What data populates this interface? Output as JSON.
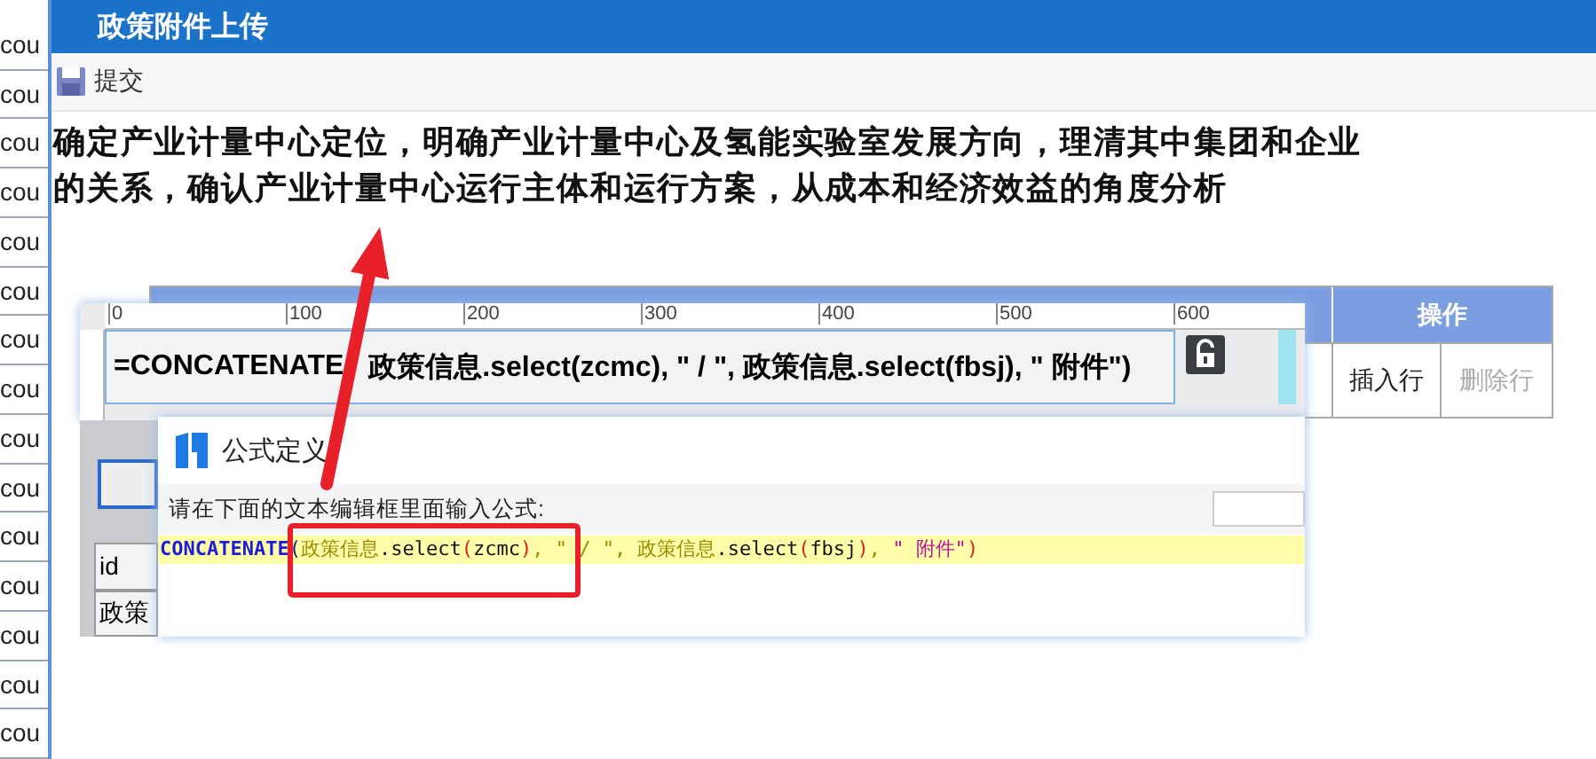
{
  "sidebar": {
    "items": [
      {
        "label": "cou"
      },
      {
        "label": "cou"
      },
      {
        "label": "cou"
      },
      {
        "label": "cou"
      },
      {
        "label": "cou"
      },
      {
        "label": "cou"
      },
      {
        "label": "cou"
      },
      {
        "label": "cou"
      },
      {
        "label": "cou"
      },
      {
        "label": "cou"
      },
      {
        "label": "cou"
      },
      {
        "label": "cou"
      },
      {
        "label": "cou"
      },
      {
        "label": "cou"
      },
      {
        "label": "cou"
      }
    ]
  },
  "window": {
    "title": "政策附件上传"
  },
  "toolbar": {
    "buttons": [
      {
        "label": "提交"
      }
    ]
  },
  "description": "确定产业计量中心定位，明确产业计量中心及氢能实验室发展方向，理清其中集团和企业的关系，确认产业计量中心运行主体和运行方案，从成本和经济效益的角度分析",
  "table": {
    "columns": [
      {
        "label": "操作"
      }
    ],
    "rows": [
      {
        "actions": [
          {
            "label": "插入行",
            "disabled": false
          },
          {
            "label": "删除行",
            "disabled": true
          }
        ]
      }
    ]
  },
  "formula_bar": {
    "ruler_marks": [
      "0",
      "100",
      "200",
      "300",
      "400",
      "500",
      "600"
    ],
    "segments": [
      "=CONCATENATE",
      "政策信息.select(zcmc), \" / \", 政策信息.select(fbsj), \" 附件\")"
    ]
  },
  "sheet": {
    "cells": [
      "id",
      "政策"
    ]
  },
  "dialog": {
    "title": "公式定义",
    "prompt": "请在下面的文本编辑框里面输入公式:",
    "formula_tokens": [
      {
        "text": "CONCATENATE",
        "kind": "function"
      },
      {
        "text": "(",
        "kind": "bracket"
      },
      {
        "text": "政策信息",
        "kind": "name"
      },
      {
        "text": ".select",
        "kind": "plain"
      },
      {
        "text": "(",
        "kind": "paren"
      },
      {
        "text": "zcmc",
        "kind": "plain"
      },
      {
        "text": ")",
        "kind": "paren"
      },
      {
        "text": ", \" / \", 政策信息",
        "kind": "name"
      },
      {
        "text": ".select",
        "kind": "plain"
      },
      {
        "text": "(",
        "kind": "paren"
      },
      {
        "text": "fbsj",
        "kind": "plain"
      },
      {
        "text": ")",
        "kind": "paren"
      },
      {
        "text": ", ",
        "kind": "name"
      },
      {
        "text": "\" 附件\"",
        "kind": "literal"
      },
      {
        "text": ")",
        "kind": "paren"
      }
    ]
  }
}
